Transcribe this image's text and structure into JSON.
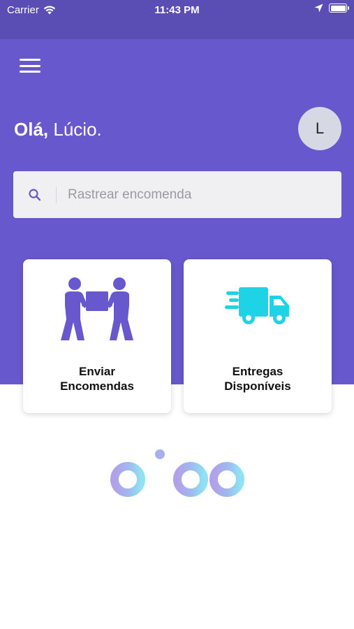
{
  "status_bar": {
    "carrier": "Carrier",
    "time": "11:43 PM"
  },
  "header": {
    "greeting_hello": "Olá,",
    "greeting_name": "Lúcio.",
    "avatar_initial": "L"
  },
  "search": {
    "placeholder": "Rastrear encomenda",
    "value": ""
  },
  "cards": [
    {
      "line1": "Enviar",
      "line2": "Encomendas",
      "icon": "people-carrying-box-icon"
    },
    {
      "line1": "Entregas",
      "line2": "Disponíveis",
      "icon": "delivery-truck-icon"
    }
  ],
  "logo": {
    "text": "dipo"
  },
  "colors": {
    "header": "#6759cd",
    "status_bar": "#5a4db4",
    "purple_icon": "#6759cd",
    "truck_icon": "#1ed3e6"
  }
}
